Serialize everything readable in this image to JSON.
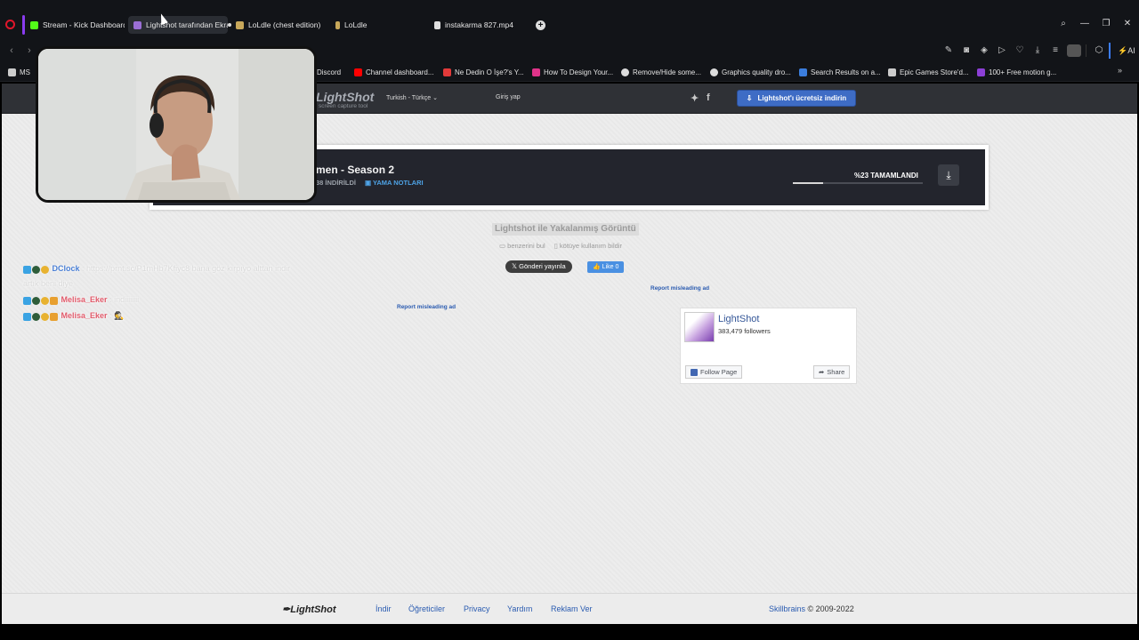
{
  "tabs": [
    {
      "label": "Stream - Kick Dashboard",
      "icon": "kick-icon",
      "color": "#53fc18"
    },
    {
      "label": "Lightshot tarafından Ekran",
      "icon": "lightshot-icon",
      "color": "#9b6fd6"
    },
    {
      "label": "LoLdle (chest edition)",
      "icon": "loldle-icon",
      "color": "#c8a85a"
    },
    {
      "label": "LoLdle",
      "icon": "loldle-icon",
      "color": "#c8a85a"
    },
    {
      "label": "instakarma 827.mp4",
      "icon": "file-icon",
      "color": "#e0e0e0"
    }
  ],
  "bookmarks": [
    {
      "label": "MS",
      "color": "#cccccc"
    },
    {
      "label": "Discord",
      "color": "#5865f2"
    },
    {
      "label": "Channel dashboard...",
      "color": "#ff0000"
    },
    {
      "label": "Ne Dedin O İşe?'s Y...",
      "color": "#e23a3a"
    },
    {
      "label": "How To Design Your...",
      "color": "#e0338a"
    },
    {
      "label": "Remove/Hide some...",
      "color": "#dddddd"
    },
    {
      "label": "Graphics quality dro...",
      "color": "#dddddd"
    },
    {
      "label": "Search Results on a...",
      "color": "#3b7ddd"
    },
    {
      "label": "Epic Games Store'd...",
      "color": "#cccccc"
    },
    {
      "label": "100+ Free motion g...",
      "color": "#8c3fd6"
    }
  ],
  "toolbar": {
    "ai_label": "AI"
  },
  "lightshot": {
    "logo": "LightShot",
    "tagline": "screen capture tool",
    "language": "Turkish - Türkçe",
    "login": "Giriş yap",
    "download_button": "Lightshot'ı ücretsiz indirin",
    "caption": "Lightshot ile Yakalanmış Görüntü",
    "similar": "benzerini bul",
    "report_abuse": "kötüye kullanım bildir",
    "tweet": "Gönderi yayınla",
    "like": "Like 0",
    "report_ad": "Report misleading ad"
  },
  "ad": {
    "title": "men - Season 2",
    "downloads": "38 İNDİRİLDİ",
    "notes": "YAMA NOTLARI",
    "progress_text": "%23 TAMAMLANDI",
    "progress": 0.23
  },
  "facebook": {
    "name": "LightShot",
    "followers": "383,479 followers",
    "follow": "Follow Page",
    "share": "Share"
  },
  "chat": [
    {
      "user": "DClock",
      "user_color": "#4a7fd4",
      "text": ": https://prnt.sc/P1mHb7Kfiyc8 bana göz kırpıyo alttan indir"
    },
    {
      "user": "",
      "user_color": "#4a7fd4",
      "text": "artık beni diye"
    },
    {
      "user": "Melisa_Eker",
      "user_color": "#e05a6a",
      "text": ": indiiiiiiii"
    },
    {
      "user": "Melisa_Eker",
      "user_color": "#e05a6a",
      "text": ": 🕵"
    }
  ],
  "footer": {
    "logo": "LightShot",
    "links": [
      "İndir",
      "Öğreticiler",
      "Privacy",
      "Yardım",
      "Reklam Ver"
    ],
    "company": "Skillbrains",
    "copyright": "© 2009-2022"
  }
}
